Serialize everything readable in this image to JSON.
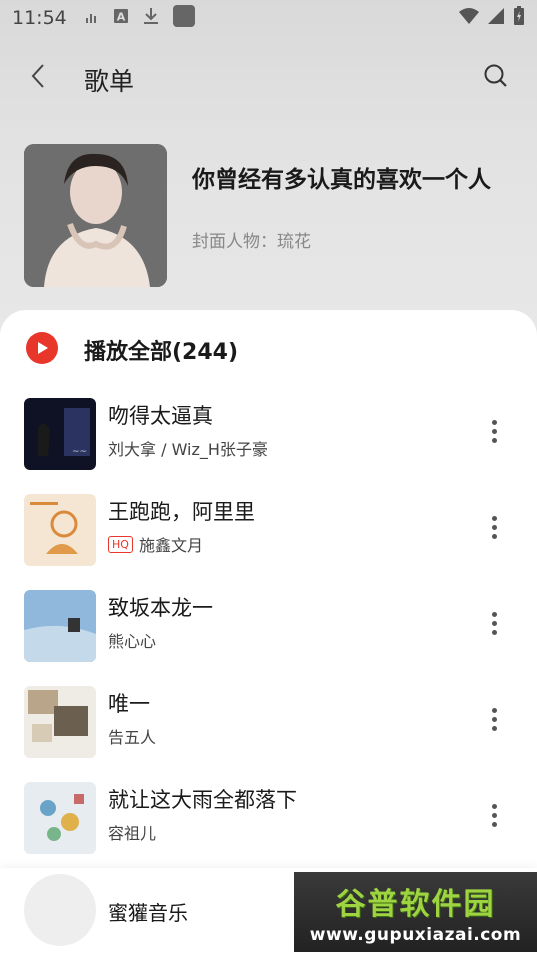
{
  "status_bar": {
    "time": "11:54",
    "left_icons": [
      "signal-bars-icon",
      "text-a-icon",
      "download-icon",
      "app-square-icon"
    ],
    "right_icons": [
      "wifi-icon",
      "cellular-icon",
      "battery-charging-icon"
    ]
  },
  "toolbar": {
    "title": "歌单",
    "back_icon": "back-chevron-icon",
    "search_icon": "search-icon"
  },
  "playlist": {
    "title": "你曾经有多认真的喜欢一个人",
    "cover_credit": "封面人物：琉花"
  },
  "play_all": {
    "label": "播放全部(244)",
    "icon": "play-circle-icon",
    "accent": "#e8362b"
  },
  "songs": [
    {
      "title": "吻得太逼真",
      "artist": "刘大拿 / Wiz_H张子豪",
      "hq": false
    },
    {
      "title": "王跑跑，阿里里",
      "artist": "施鑫文月",
      "hq": true,
      "badge": "HQ"
    },
    {
      "title": "致坂本龙一",
      "artist": "熊心心",
      "hq": false
    },
    {
      "title": "唯一",
      "artist": "告五人",
      "hq": false
    },
    {
      "title": "就让这大雨全都落下",
      "artist": "容祖儿",
      "hq": false
    }
  ],
  "mini_player": {
    "label": "蜜獾音乐"
  },
  "watermark": {
    "logo": "谷普软件园",
    "url": "www.gupuxiazai.com"
  }
}
